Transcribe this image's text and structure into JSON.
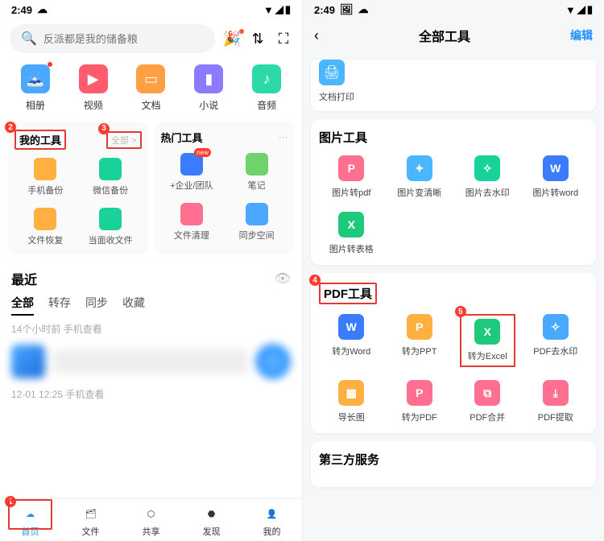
{
  "left": {
    "status_time": "2:49",
    "search_placeholder": "反派都是我的储备粮",
    "categories": [
      {
        "label": "相册",
        "icon": "photo",
        "color": "#4aa8ff",
        "dot": true
      },
      {
        "label": "视频",
        "icon": "video",
        "color": "#ff5b6e"
      },
      {
        "label": "文档",
        "icon": "doc",
        "color": "#ff9f43"
      },
      {
        "label": "小说",
        "icon": "novel",
        "color": "#8c7bff"
      },
      {
        "label": "音频",
        "icon": "audio",
        "color": "#2cd9a8"
      }
    ],
    "my_tools_title": "我的工具",
    "my_tools_more": "全部 >",
    "hot_tools_title": "热门工具",
    "my_tools": [
      {
        "label": "手机备份",
        "color": "#ffb040"
      },
      {
        "label": "微信备份",
        "color": "#19d29a"
      },
      {
        "label": "文件恢复",
        "color": "#ffb040"
      },
      {
        "label": "当面收文件",
        "color": "#19d29a"
      }
    ],
    "hot_tools": [
      {
        "label": "+企业/团队",
        "color": "#3b7cff",
        "badge": "new"
      },
      {
        "label": "笔记",
        "color": "#6ed36c"
      },
      {
        "label": "文件清理",
        "color": "#ff6f8f"
      },
      {
        "label": "同步空间",
        "color": "#4aa8ff"
      }
    ],
    "recent_title": "最近",
    "tabs": [
      "全部",
      "转存",
      "同步",
      "收藏"
    ],
    "tab_active": 0,
    "meta1": "14个小时前  手机查看",
    "meta2": "12-01 12:25  手机查看",
    "nav": [
      {
        "label": "首页",
        "icon": "home",
        "active": true
      },
      {
        "label": "文件",
        "icon": "file"
      },
      {
        "label": "共享",
        "icon": "share"
      },
      {
        "label": "发现",
        "icon": "discover"
      },
      {
        "label": "我的",
        "icon": "me"
      }
    ],
    "badges": {
      "home": "1",
      "mytools": "2",
      "more": "3"
    }
  },
  "right": {
    "status_time": "2:49",
    "header_title": "全部工具",
    "header_edit": "编辑",
    "doc_print_label": "文档打印",
    "doc_print_color": "#49b6ff",
    "sections": [
      {
        "title": "图片工具",
        "items": [
          {
            "label": "图片转pdf",
            "color": "#ff6f8f",
            "glyph": "P"
          },
          {
            "label": "图片变清晰",
            "color": "#49b6ff",
            "glyph": "✦"
          },
          {
            "label": "图片去水印",
            "color": "#19d29a",
            "glyph": "✧"
          },
          {
            "label": "图片转word",
            "color": "#3b7cff",
            "glyph": "W"
          },
          {
            "label": "图片转表格",
            "color": "#1fc97c",
            "glyph": "X"
          }
        ]
      },
      {
        "title": "PDF工具",
        "title_badge": "4",
        "items": [
          {
            "label": "转为Word",
            "color": "#3b7cff",
            "glyph": "W"
          },
          {
            "label": "转为PPT",
            "color": "#ffb040",
            "glyph": "P"
          },
          {
            "label": "转为Excel",
            "color": "#1fc97c",
            "glyph": "X",
            "badge": "5",
            "boxed": true
          },
          {
            "label": "PDF去水印",
            "color": "#4aa8ff",
            "glyph": "✧"
          },
          {
            "label": "导长图",
            "color": "#ffb040",
            "glyph": "▦"
          },
          {
            "label": "转为PDF",
            "color": "#ff6f8f",
            "glyph": "P"
          },
          {
            "label": "PDF合并",
            "color": "#ff6f8f",
            "glyph": "⧉"
          },
          {
            "label": "PDF提取",
            "color": "#ff6f8f",
            "glyph": "⤓"
          }
        ]
      },
      {
        "title": "第三方服务",
        "items": []
      }
    ]
  }
}
